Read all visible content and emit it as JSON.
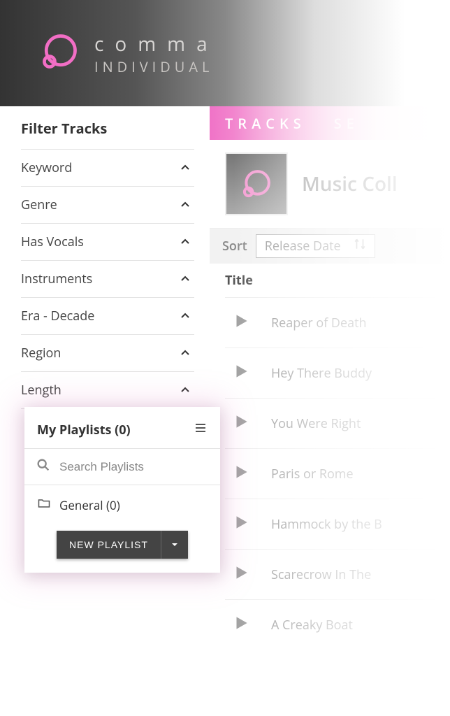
{
  "header": {
    "brand": "comma",
    "tier": "INDIVIDUAL"
  },
  "sidebar": {
    "title": "Filter Tracks",
    "filters": [
      {
        "label": "Keyword"
      },
      {
        "label": "Genre"
      },
      {
        "label": "Has Vocals"
      },
      {
        "label": "Instruments"
      },
      {
        "label": "Era - Decade"
      },
      {
        "label": "Region"
      },
      {
        "label": "Length"
      }
    ]
  },
  "tabs": {
    "tracks": "TRACKS",
    "second": "SE"
  },
  "collection": {
    "title": "Music Coll"
  },
  "sort": {
    "label": "Sort",
    "value": "Release Date"
  },
  "columns": {
    "title": "Title"
  },
  "tracks_list": [
    {
      "title": "Reaper of Death"
    },
    {
      "title": "Hey There Buddy"
    },
    {
      "title": "You Were Right"
    },
    {
      "title": "Paris or Rome"
    },
    {
      "title": "Hammock by the B"
    },
    {
      "title": "Scarecrow In The"
    },
    {
      "title": "A Creaky Boat"
    }
  ],
  "playlists": {
    "title": "My Playlists (0)",
    "search_placeholder": "Search Playlists",
    "folder": "General (0)",
    "new_label": "NEW PLAYLIST"
  }
}
